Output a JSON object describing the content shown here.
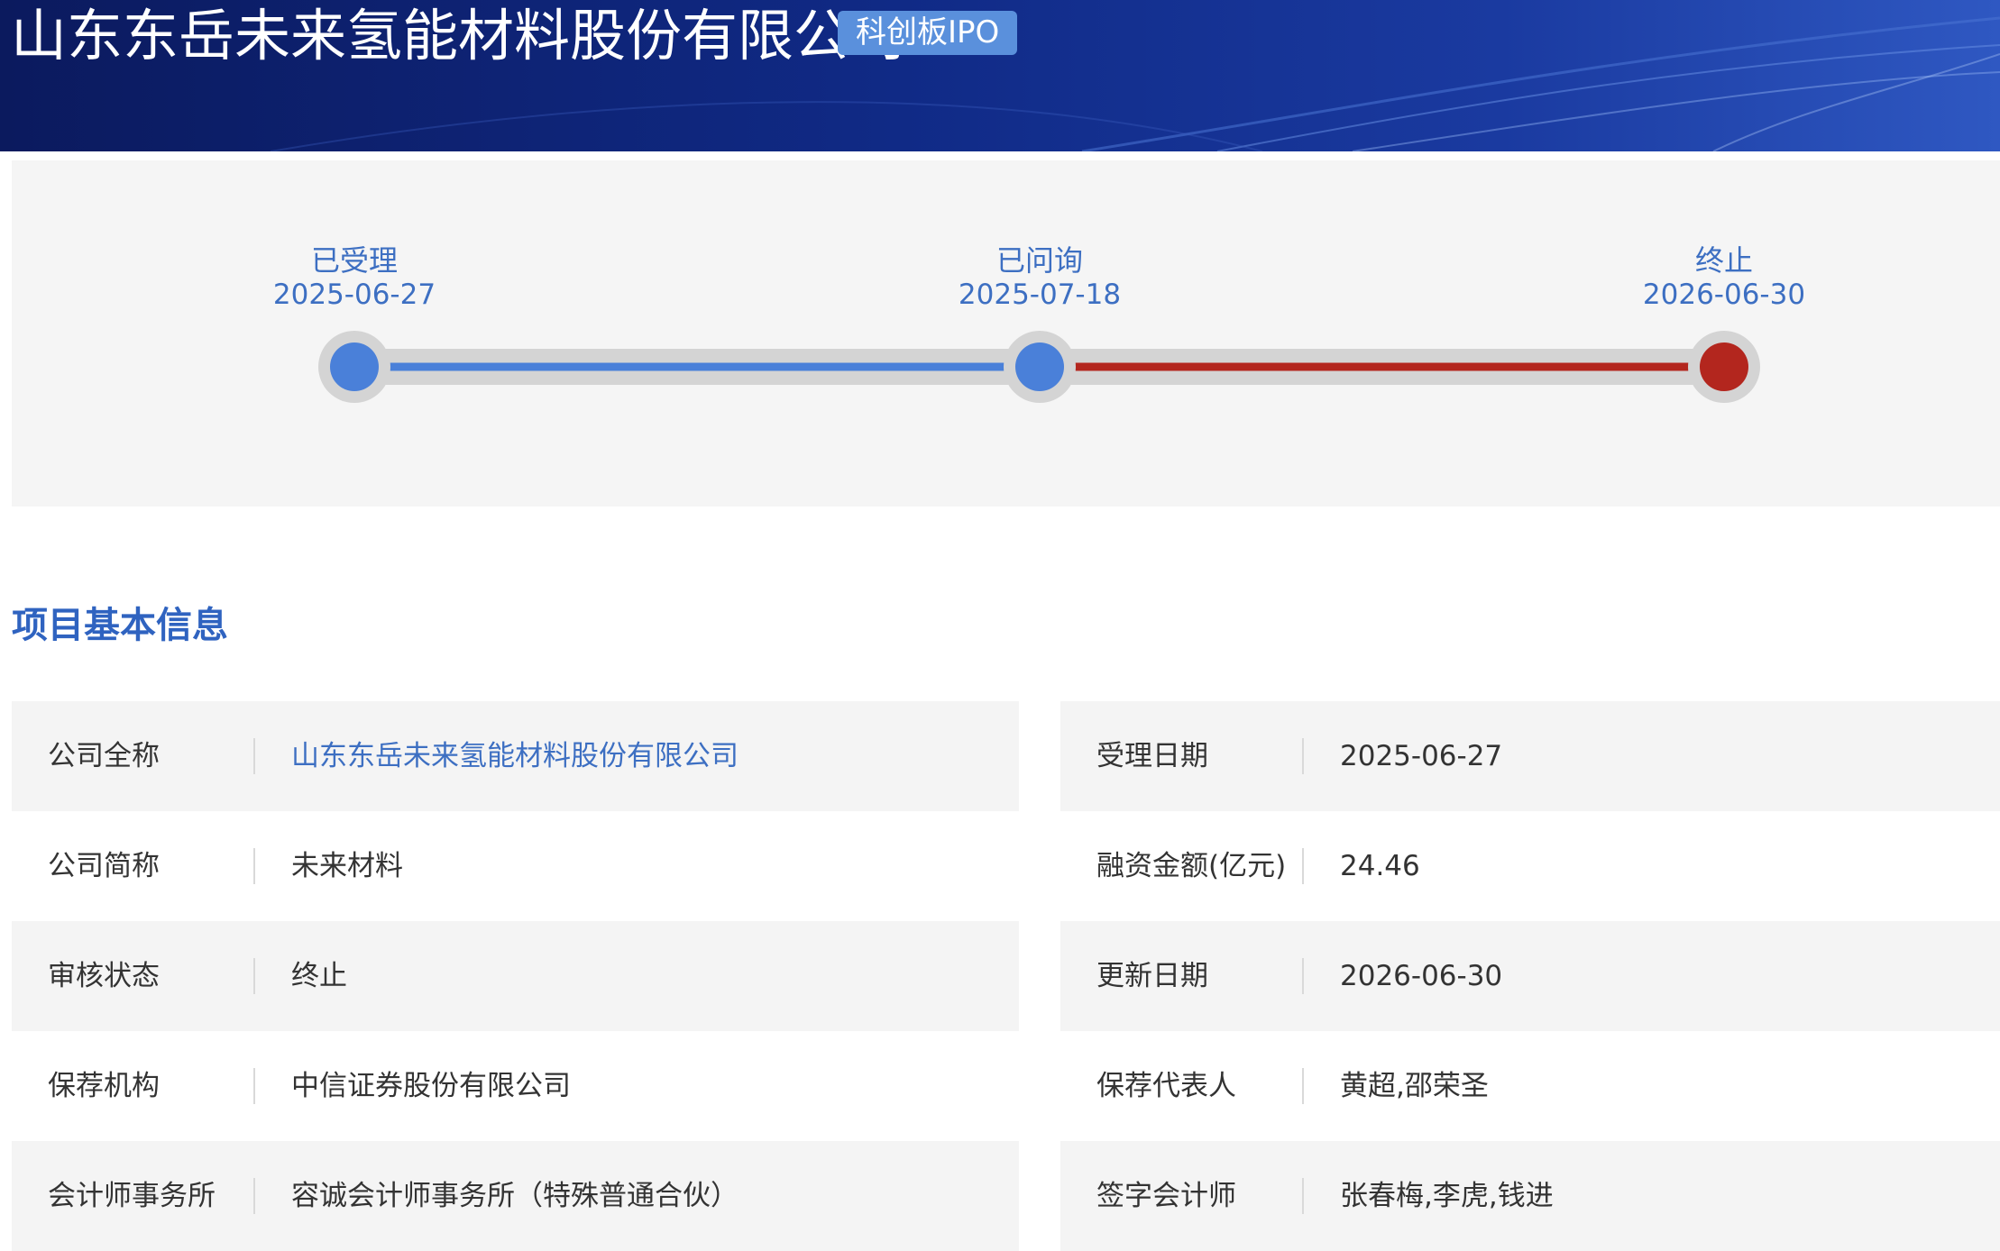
{
  "header": {
    "company_name": "山东东岳未来氢能材料股份有限公司",
    "board_badge": "科创板IPO"
  },
  "timeline": {
    "stages": [
      {
        "label": "已受理",
        "date": "2025-06-27",
        "state": "done"
      },
      {
        "label": "已问询",
        "date": "2025-07-18",
        "state": "done"
      },
      {
        "label": "终止",
        "date": "2026-06-30",
        "state": "terminated"
      }
    ],
    "colors": {
      "done": "#4a80d9",
      "terminated": "#b3261e",
      "track": "#d4d4d4"
    }
  },
  "section": {
    "title": "项目基本信息"
  },
  "info": {
    "left": [
      {
        "label": "公司全称",
        "value": "山东东岳未来氢能材料股份有限公司",
        "is_link": true
      },
      {
        "label": "公司简称",
        "value": "未来材料",
        "is_link": false
      },
      {
        "label": "审核状态",
        "value": "终止",
        "is_link": false
      },
      {
        "label": "保荐机构",
        "value": "中信证券股份有限公司",
        "is_link": false
      },
      {
        "label": "会计师事务所",
        "value": "容诚会计师事务所（特殊普通合伙）",
        "is_link": false
      }
    ],
    "right": [
      {
        "label": "受理日期",
        "value": "2025-06-27"
      },
      {
        "label": "融资金额(亿元)",
        "value": "24.46"
      },
      {
        "label": "更新日期",
        "value": "2026-06-30"
      },
      {
        "label": "保荐代表人",
        "value": "黄超,邵荣圣"
      },
      {
        "label": "签字会计师",
        "value": "张春梅,李虎,钱进"
      }
    ]
  }
}
